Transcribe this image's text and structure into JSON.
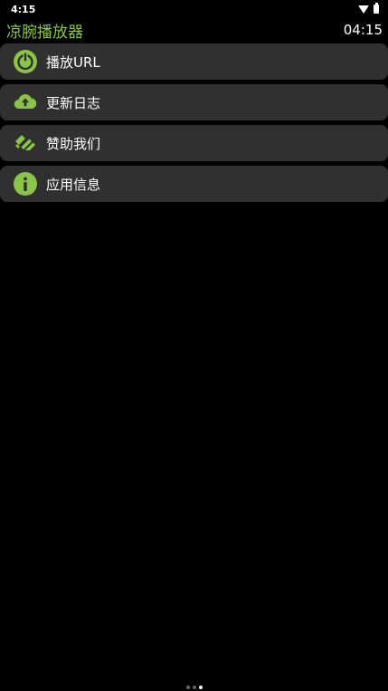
{
  "status_bar": {
    "time": "4:15",
    "icons": [
      "wifi-icon",
      "battery-icon"
    ]
  },
  "header": {
    "title": "凉腕播放器",
    "clock": "04:15"
  },
  "menu": {
    "items": [
      {
        "label": "播放URL",
        "icon": "power-icon"
      },
      {
        "label": "更新日志",
        "icon": "cloud-upload-icon"
      },
      {
        "label": "赞助我们",
        "icon": "handshake-icon"
      },
      {
        "label": "应用信息",
        "icon": "info-icon"
      }
    ]
  },
  "pager": {
    "pages": 3,
    "active": 3
  },
  "colors": {
    "accent": "#8bc34a",
    "background": "#000000",
    "item_background": "#303030",
    "text": "#ffffff"
  }
}
